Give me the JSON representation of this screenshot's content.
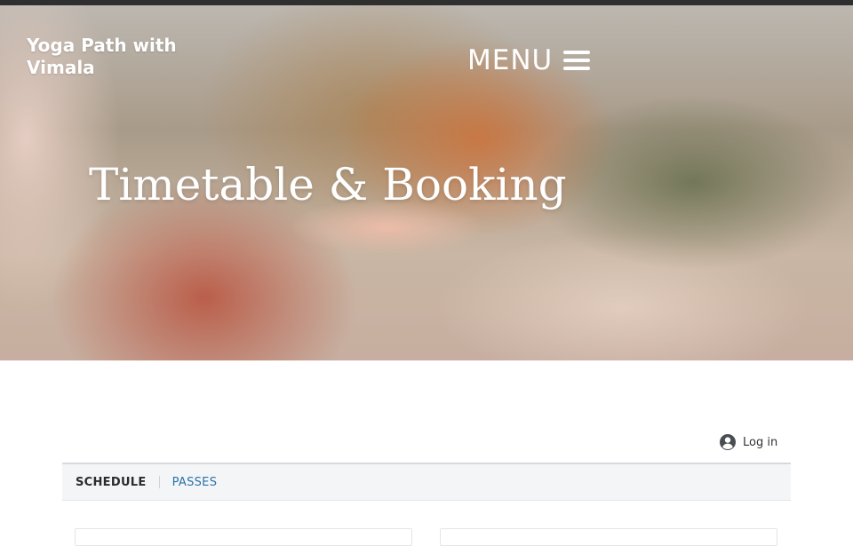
{
  "header": {
    "site_title": "Yoga Path with Vimala",
    "menu_label": "MENU",
    "menu_icon": "hamburger-icon"
  },
  "hero": {
    "title": "Timetable & Booking"
  },
  "account": {
    "login_label": "Log in",
    "login_icon": "user-circle-icon"
  },
  "tabs": {
    "items": [
      {
        "label": "SCHEDULE",
        "active": true
      },
      {
        "label": "PASSES",
        "active": false
      }
    ]
  },
  "colors": {
    "link": "#2a73a8",
    "tab_bar_bg": "#f4f5f7",
    "text_dark": "#2b2b2b"
  }
}
